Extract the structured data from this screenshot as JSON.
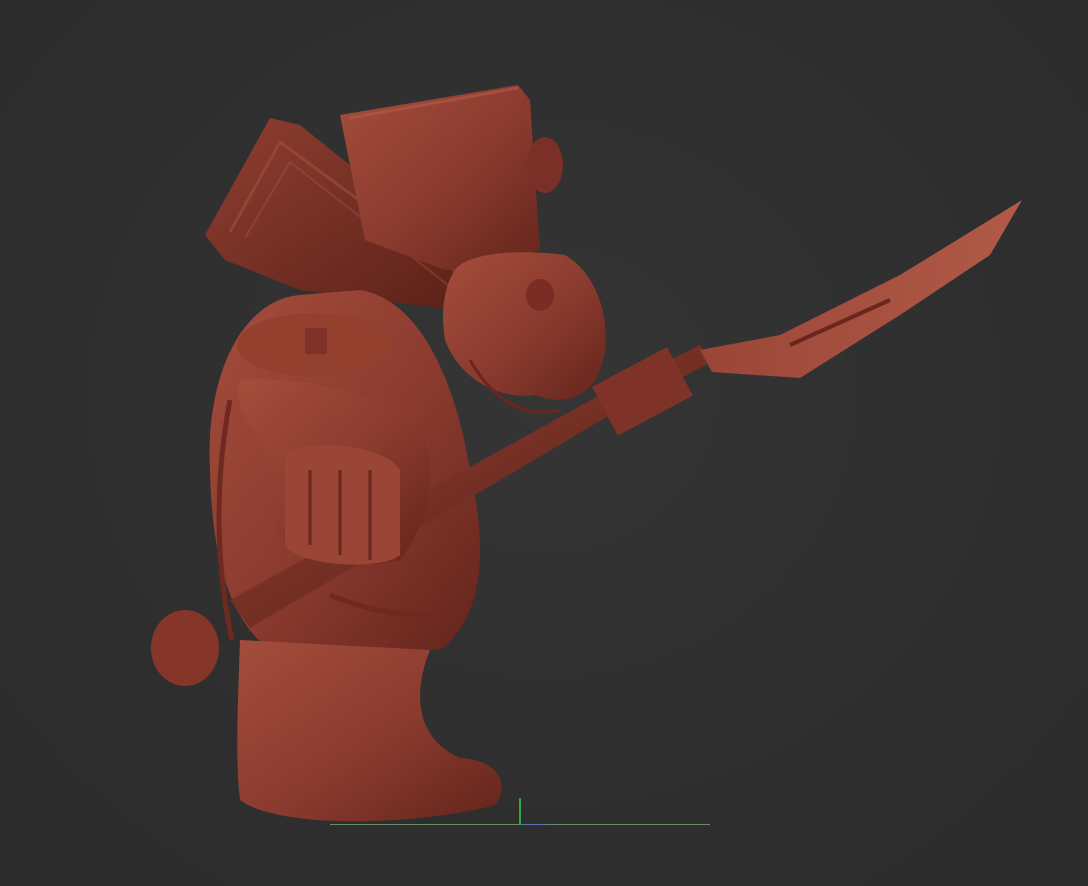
{
  "viewport": {
    "background": "#2e2e2e",
    "model_color": "#8a3a2e",
    "model_highlight": "#a6503f",
    "model_shadow": "#5c2219",
    "axis_colors": {
      "x_axis": "#6c8a68",
      "y_axis": "#2fa84a",
      "z_axis": "#5a6fb0"
    }
  }
}
